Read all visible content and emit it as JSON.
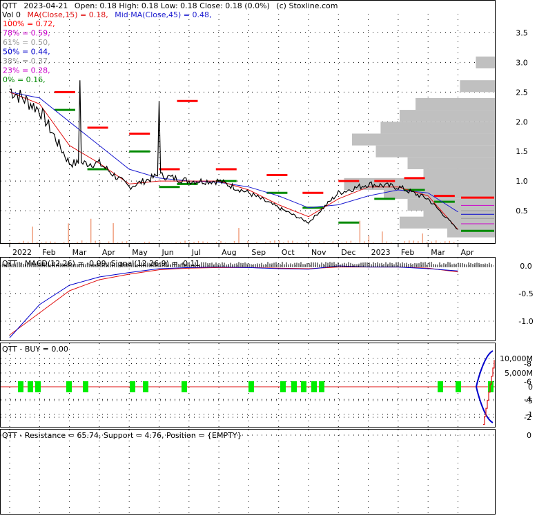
{
  "colors": {
    "price_line": "#000000",
    "ma_fast": "#e01010",
    "ma_mid": "#1a1ad0",
    "resistance_bar": "#ff0000",
    "support_bar": "#008a00",
    "volume_profile": "#c0c0c0",
    "volume_bar": "#f0a080",
    "fib_100": "#ff0000",
    "fib_78": "#cc00cc",
    "fib_61": "#999999",
    "fib_50": "#0000cc",
    "fib_38": "#999999",
    "fib_23": "#cc00cc",
    "fib_0": "#008a00",
    "macd": "#0000cc",
    "signal": "#e01010",
    "buy_marker": "#00ee00",
    "resistance_line": "#e01010"
  },
  "price_panel": {
    "header_ticker": "QTT",
    "header_date": "2023-04-21",
    "header_ohlc": "Open: 0.18  High: 0.18  Low: 0.18  Close: 0.18 (0.0%)",
    "header_source": "(c) Stoxline.com",
    "vol_label": "Vol 0",
    "ma15_label": "MA(Close,15) = 0.18,",
    "ma45_label": "Mid MA(Close,45) = 0.48,",
    "fib_levels": [
      {
        "label": "100% = 0.72,",
        "color": "#ff0000"
      },
      {
        "label": "78% = 0.59,",
        "color": "#cc00cc"
      },
      {
        "label": "61% = 0.50,",
        "color": "#999999"
      },
      {
        "label": "50% = 0.44,",
        "color": "#0000cc"
      },
      {
        "label": "38% = 0.37,",
        "color": "#999999"
      },
      {
        "label": "23% = 0.28,",
        "color": "#cc00cc"
      },
      {
        "label": "0% = 0.16,",
        "color": "#008a00"
      }
    ],
    "y_ticks": [
      "3.5",
      "3.0",
      "2.5",
      "2.0",
      "1.5",
      "1.0",
      "0.5"
    ],
    "x_ticks": [
      "2022",
      "Feb",
      "Mar",
      "Apr",
      "May",
      "Jun",
      "Jul",
      "Aug",
      "Sep",
      "Oct",
      "Nov",
      "Dec",
      "2023",
      "Feb",
      "Mar",
      "Apr"
    ]
  },
  "macd_panel": {
    "label": "QTT - MACD(12,26) = -0.09, Signal(12,26,9) = -0.11",
    "y_ticks": [
      "0.0",
      "-0.5",
      "-1.0"
    ]
  },
  "buy_panel": {
    "label": "QTT - BUY = 0.00",
    "y_ticks": [
      "10,000M",
      "5,000M",
      "0",
      "-5",
      "-1"
    ]
  },
  "resistance_panel": {
    "label": "QTT - Resistance = 65.74, Support = 4.76, Position = {EMPTY}",
    "y_ticks": [
      "0",
      "-2",
      "-4",
      "-6",
      "-8"
    ]
  },
  "chart_data": {
    "type": "line",
    "title": "QTT  2023-04-21 Open: 0.18  High: 0.18  Low: 0.18  Close: 0.18 (0.0%)",
    "x": [
      "2022-01",
      "2022-02",
      "2022-03",
      "2022-04",
      "2022-05",
      "2022-06",
      "2022-07",
      "2022-08",
      "2022-09",
      "2022-10",
      "2022-11",
      "2022-12",
      "2023-01",
      "2023-02",
      "2023-03",
      "2023-04"
    ],
    "series": [
      {
        "name": "Close",
        "values": [
          2.55,
          2.2,
          1.3,
          1.3,
          0.9,
          1.1,
          1.0,
          1.0,
          0.8,
          0.55,
          0.3,
          0.8,
          0.95,
          0.9,
          0.7,
          0.18
        ]
      },
      {
        "name": "MA(Close,15)",
        "values": [
          2.5,
          2.3,
          1.6,
          1.3,
          0.95,
          1.0,
          1.0,
          1.0,
          0.85,
          0.6,
          0.4,
          0.7,
          0.9,
          0.9,
          0.75,
          0.18
        ]
      },
      {
        "name": "Mid MA(Close,45)",
        "values": [
          2.5,
          2.4,
          2.0,
          1.6,
          1.2,
          1.05,
          1.0,
          0.98,
          0.9,
          0.75,
          0.55,
          0.6,
          0.75,
          0.85,
          0.8,
          0.48
        ]
      }
    ],
    "ylim": [
      0.0,
      3.75
    ],
    "fibonacci": [
      {
        "level": "100%",
        "value": 0.72
      },
      {
        "level": "78%",
        "value": 0.59
      },
      {
        "level": "61%",
        "value": 0.5
      },
      {
        "level": "50%",
        "value": 0.44
      },
      {
        "level": "38%",
        "value": 0.37
      },
      {
        "level": "23%",
        "value": 0.28
      },
      {
        "level": "0%",
        "value": 0.16
      }
    ],
    "volume_profile": [
      {
        "price": 3.0,
        "weight": 0.12
      },
      {
        "price": 2.6,
        "weight": 0.22
      },
      {
        "price": 2.3,
        "weight": 0.5
      },
      {
        "price": 2.1,
        "weight": 0.6
      },
      {
        "price": 1.9,
        "weight": 0.72
      },
      {
        "price": 1.7,
        "weight": 0.9
      },
      {
        "price": 1.5,
        "weight": 0.75
      },
      {
        "price": 1.3,
        "weight": 0.55
      },
      {
        "price": 1.1,
        "weight": 0.45
      },
      {
        "price": 0.95,
        "weight": 0.95
      },
      {
        "price": 0.8,
        "weight": 0.7
      },
      {
        "price": 0.6,
        "weight": 0.55
      },
      {
        "price": 0.45,
        "weight": 0.45
      },
      {
        "price": 0.3,
        "weight": 0.6
      },
      {
        "price": 0.15,
        "weight": 0.3
      }
    ],
    "macd": {
      "MACD(12,26)": -0.09,
      "Signal(12,26,9)": -0.11,
      "ylim": [
        -1.35,
        0.15
      ]
    },
    "buy_signal_months": [
      "2022-01",
      "2022-02",
      "2022-03",
      "2022-05",
      "2022-06",
      "2022-09",
      "2022-10",
      "2022-11",
      "2023-03"
    ],
    "resistance": 65.74,
    "support": 4.76
  }
}
